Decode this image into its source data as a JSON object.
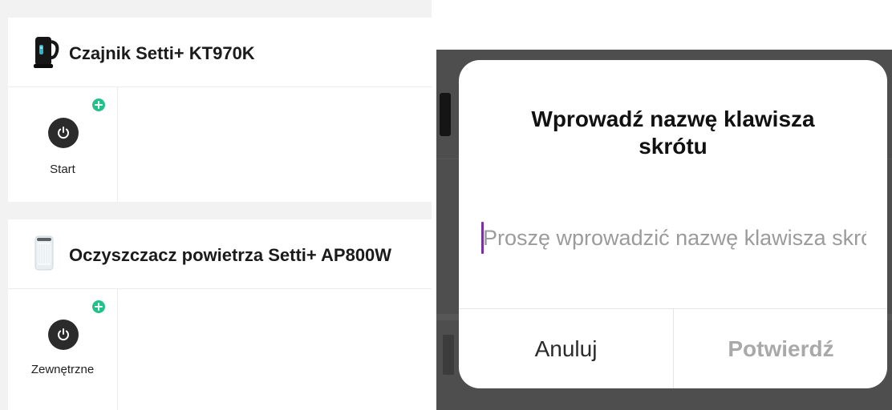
{
  "devices": [
    {
      "name": "Czajnik Setti+ KT970K",
      "icon": "kettle-icon",
      "shortcut": {
        "label": "Start",
        "icon": "power-icon",
        "badge_icon": "add-badge-icon"
      }
    },
    {
      "name": "Oczyszczacz powietrza Setti+ AP800W",
      "icon": "air-purifier-icon",
      "shortcut": {
        "label": "Zewnętrzne",
        "icon": "power-icon",
        "badge_icon": "add-badge-icon"
      }
    }
  ],
  "dialog": {
    "title": "Wprowadź nazwę klawisza skrótu",
    "input": {
      "value": "",
      "placeholder": "Proszę wprowadzić nazwę klawisza skrótu"
    },
    "cancel_label": "Anuluj",
    "confirm_label": "Potwierdź"
  },
  "colors": {
    "accent_green": "#21c18a",
    "caret_purple": "#7a2fa3",
    "power_button": "#2b2b2b",
    "overlay": "#4e4e4e",
    "disabled_text": "#a9a9a9"
  }
}
